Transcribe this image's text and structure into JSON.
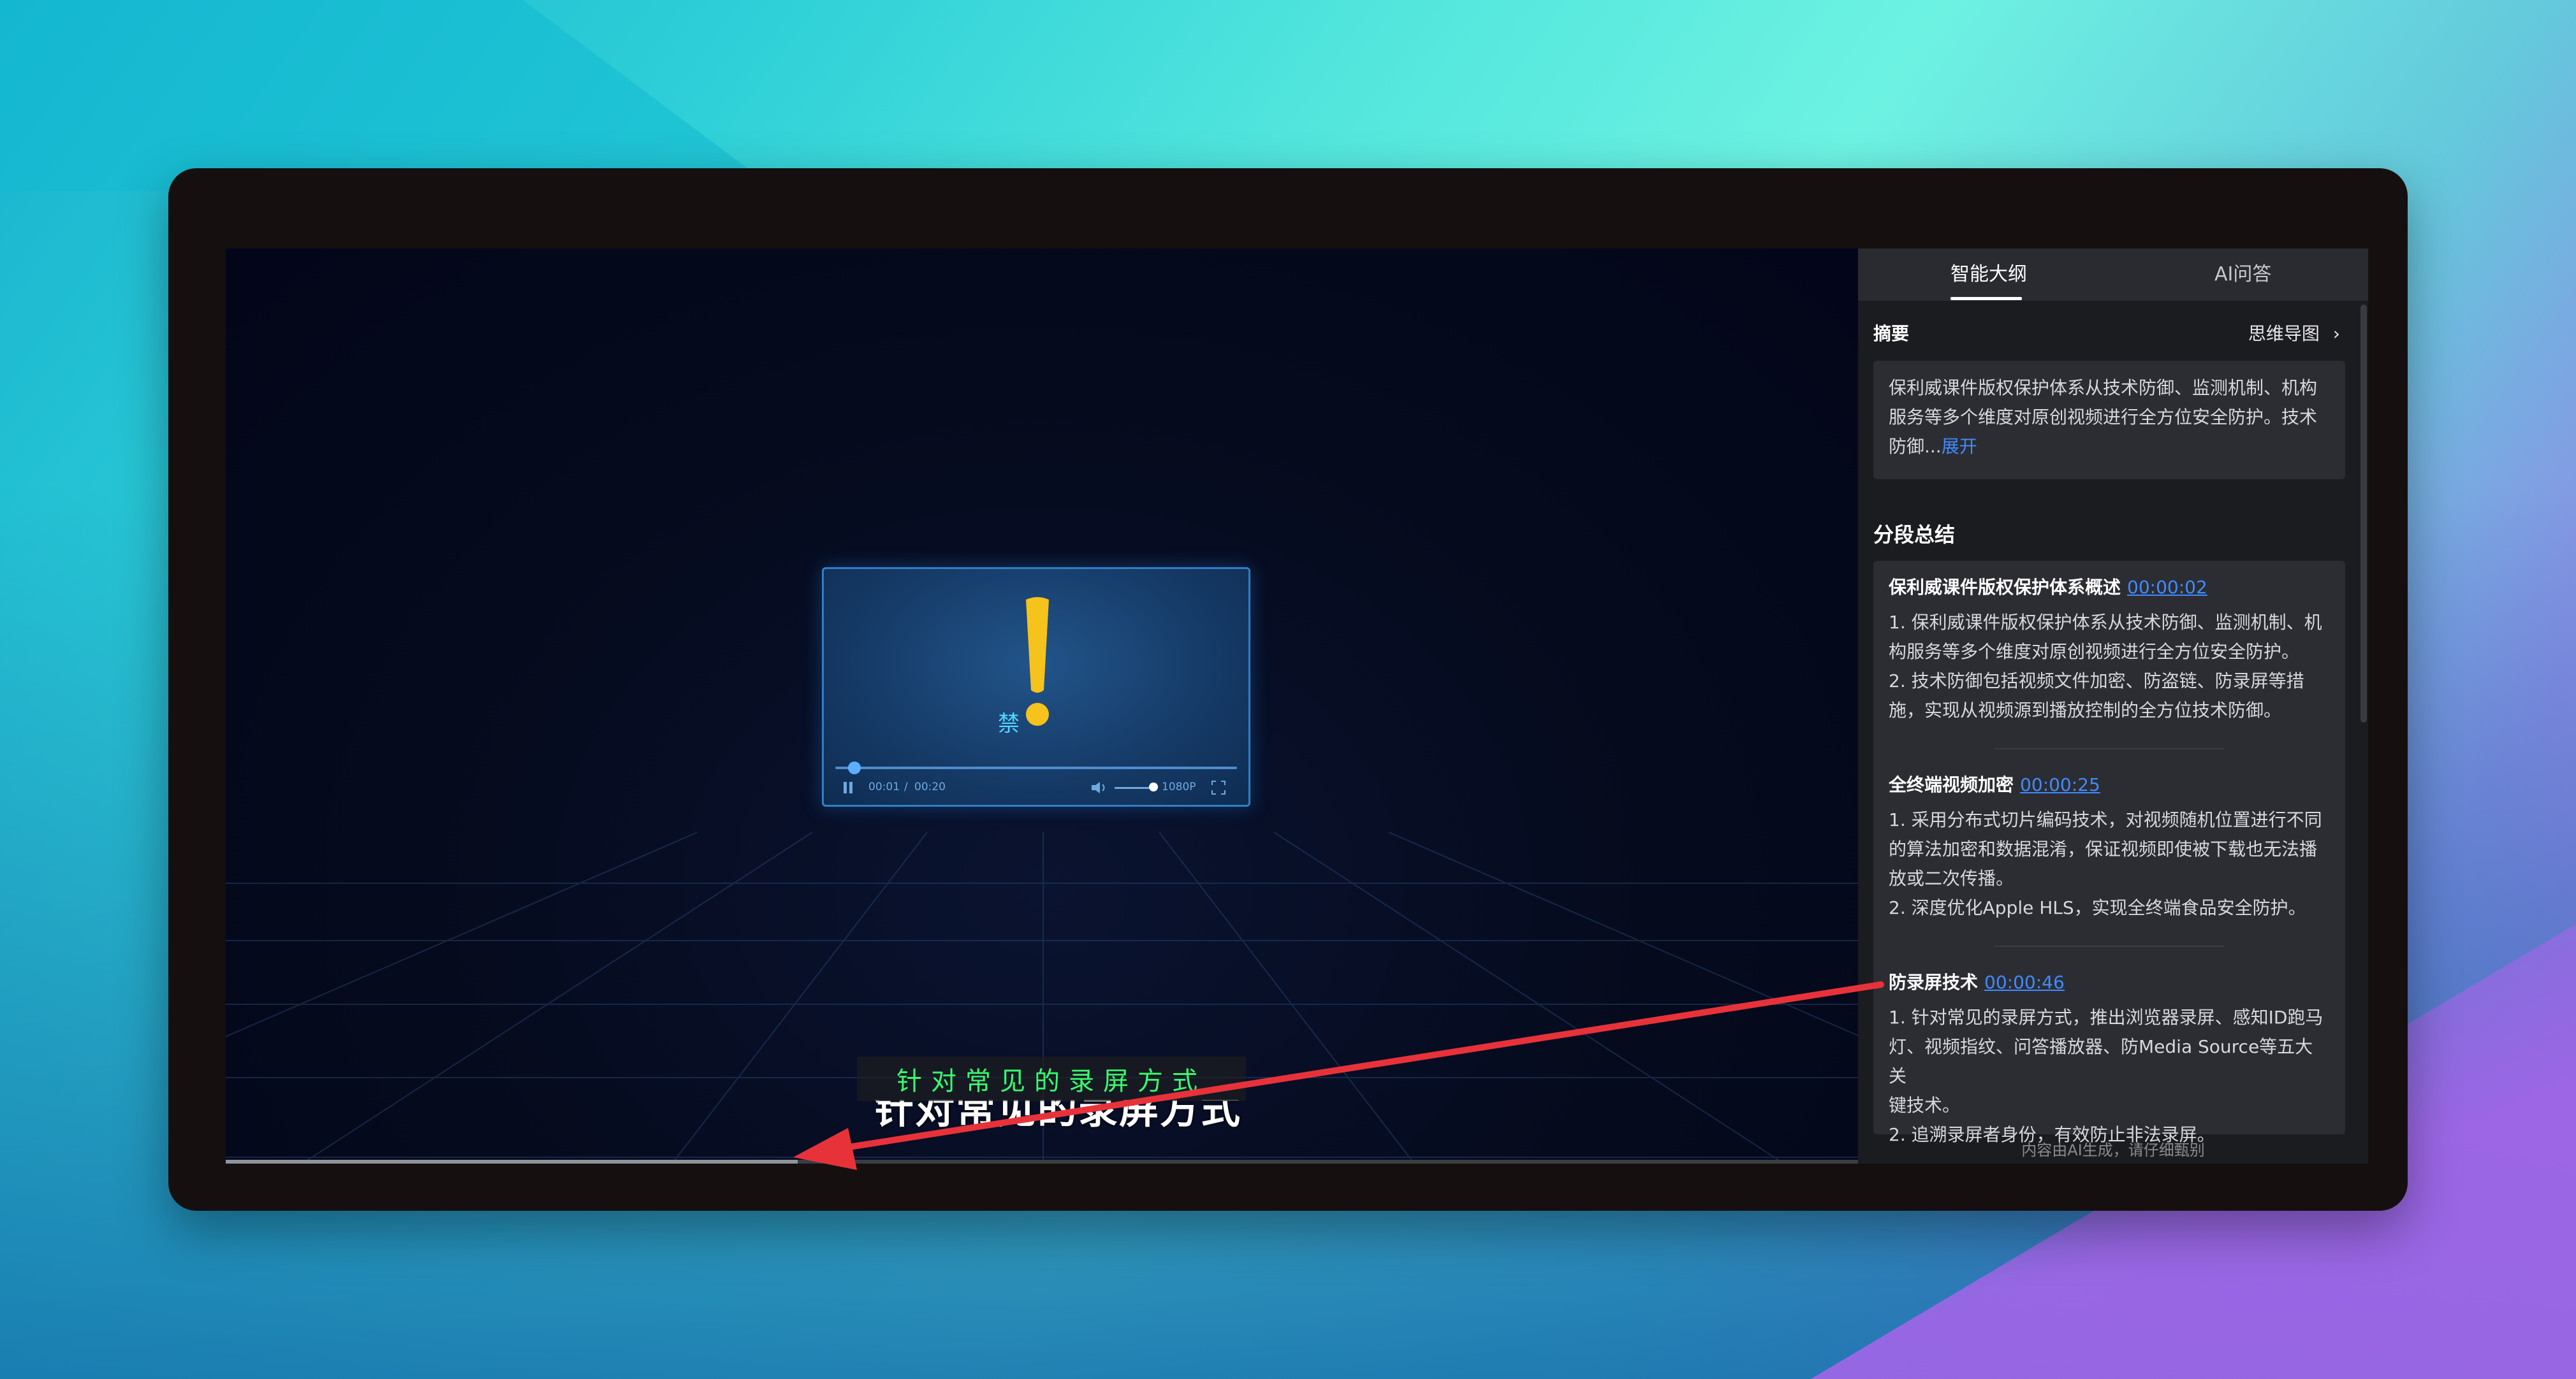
{
  "video": {
    "subtitle_small": "针对常见的录屏方式",
    "subtitle_big": "针对常见的录屏方式",
    "progress_fraction": 0.35,
    "mock_player": {
      "ban_text": "禁",
      "time_current": "00:01",
      "time_separator": "/",
      "time_total": "00:20",
      "quality": "1080P"
    }
  },
  "panel": {
    "tabs": [
      {
        "label": "智能大纲",
        "active": true
      },
      {
        "label": "AI问答",
        "active": false
      }
    ],
    "summary": {
      "title": "摘要",
      "mindmap_label": "思维导图",
      "mindmap_chevron": "›",
      "line1": "保利威课件版权保护体系从技术防御、监测机制、机构",
      "line2": "服务等多个维度对原创视频进行全方位安全防护。技术",
      "line3": "防御...",
      "expand_label": "展开"
    },
    "segments_title": "分段总结",
    "segments": [
      {
        "title": "保利威课件版权保护体系概述",
        "time": "00:00:02",
        "lines": [
          "1. 保利威课件版权保护体系从技术防御、监测机制、机",
          "构服务等多个维度对原创视频进行全方位安全防护。",
          "2. 技术防御包括视频文件加密、防盗链、防录屏等措",
          "施，实现从视频源到播放控制的全方位技术防御。"
        ]
      },
      {
        "title": "全终端视频加密",
        "time": "00:00:25",
        "lines": [
          "1. 采用分布式切片编码技术，对视频随机位置进行不同",
          "的算法加密和数据混淆，保证视频即使被下载也无法播",
          "放或二次传播。",
          "2. 深度优化Apple HLS，实现全终端食品安全防护。"
        ]
      },
      {
        "title": "防录屏技术",
        "time": "00:00:46",
        "lines": [
          "1. 针对常见的录屏方式，推出浏览器录屏、感知ID跑马",
          "灯、视频指纹、问答播放器、防Media Source等五大关",
          "键技术。",
          "2. 追溯录屏者身份，有效防止非法录屏。"
        ]
      }
    ],
    "footer_note": "内容由AI生成，请仔细甄别"
  },
  "colors": {
    "link": "#3f8bff",
    "arrow": "#e8323a",
    "subtitle_small": "#37ff70",
    "panel_bg": "#1b1c20",
    "card_bg": "#2c2d33"
  },
  "icons": [
    "exclamation-icon",
    "pause-icon",
    "volume-icon",
    "fullscreen-icon",
    "chevron-right-icon"
  ]
}
